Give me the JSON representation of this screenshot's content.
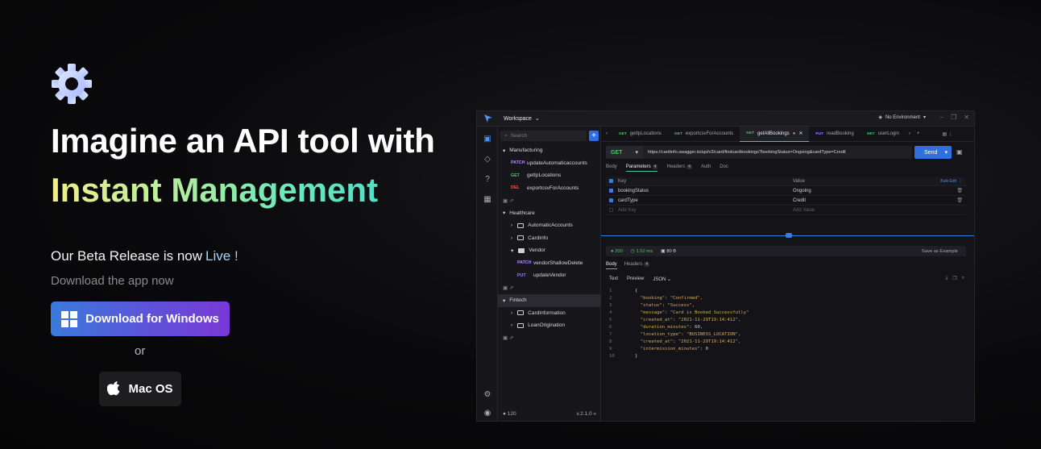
{
  "hero": {
    "headline": "Imagine an API tool with",
    "headline_gradient": "Instant Management",
    "beta_text": "Our Beta Release is now",
    "beta_live": "Live !",
    "subline": "Download the app now",
    "windows_button": "Download for Windows",
    "or": "or",
    "mac_button": "Mac OS"
  },
  "app": {
    "workspace": "Workspace",
    "environment": "No Environment",
    "search_placeholder": "Search",
    "tree": [
      {
        "type": "collection",
        "label": "Manufacturing"
      },
      {
        "type": "request",
        "method": "PATCH",
        "label": "updateAutomaticaccounts"
      },
      {
        "type": "request",
        "method": "GET",
        "label": "getIpLocations"
      },
      {
        "type": "request",
        "method": "DEL",
        "label": "exportcsvForAccounts"
      },
      {
        "type": "collection",
        "label": "Healthcare"
      },
      {
        "type": "folder",
        "label": "AutomaticAccounts"
      },
      {
        "type": "folder",
        "label": "CardInfo"
      },
      {
        "type": "folder",
        "label": "Vendor"
      },
      {
        "type": "request",
        "method": "PATCH",
        "label": "vendorShallowDelete"
      },
      {
        "type": "request",
        "method": "PUT",
        "label": "updateVendor"
      },
      {
        "type": "collection",
        "label": "Fintech"
      },
      {
        "type": "folder",
        "label": "CardInformation"
      },
      {
        "type": "folder",
        "label": "LoanOrigination"
      }
    ],
    "footer": {
      "stars": "120",
      "version": "v.2.1.0"
    },
    "tabs": [
      {
        "method": "GET",
        "label": "getIpLocations"
      },
      {
        "method": "GET",
        "label": "exportcsvForAccounts"
      },
      {
        "method": "GET",
        "label": "getAllBookings"
      },
      {
        "method": "PUT",
        "label": "readBooking"
      },
      {
        "method": "GET",
        "label": "userLogin"
      }
    ],
    "request": {
      "method": "GET",
      "url": "https://cardinfo.swagger.io/api/v3/card/findcardbookings?bookingStatus=Ongoing&cardType=Credit",
      "send": "Send"
    },
    "subtabs": {
      "body": "Body",
      "parameters": "Parameters",
      "parameters_count": "4",
      "headers": "Headers",
      "headers_count": "4",
      "auth": "Auth",
      "doc": "Doc"
    },
    "params": {
      "key_header": "Key",
      "value_header": "Value",
      "bulk_edit": "Bulk Edit",
      "rows": [
        {
          "key": "bookingStatus",
          "value": "Ongoing"
        },
        {
          "key": "cardType",
          "value": "Credit"
        }
      ],
      "add_key": "Add Key",
      "add_value": "Add Value"
    },
    "response": {
      "status": "200",
      "time": "1.52 ms",
      "size": "80 B",
      "save_example": "Save as Example",
      "tab_body": "Body",
      "tab_headers": "Headers",
      "headers_count": "4",
      "fmt_text": "Text",
      "fmt_preview": "Preview",
      "fmt_json": "JSON",
      "code": [
        {
          "n": "1",
          "t": "{"
        },
        {
          "n": "2",
          "k": "\"booking\"",
          "v": "\"Confirmed\","
        },
        {
          "n": "3",
          "k": "\"status\"",
          "v": "\"Success\","
        },
        {
          "n": "4",
          "k": "\"message\"",
          "v": "\"Card is Booked Successfully\""
        },
        {
          "n": "5",
          "k": "\"created_at\"",
          "v": "\"2021-11-29T19:14:412\","
        },
        {
          "n": "6",
          "k": "\"duration_minutes\"",
          "v": "60,"
        },
        {
          "n": "7",
          "k": "\"location_type\"",
          "v": "\"BUSINESS_LOCATION\","
        },
        {
          "n": "8",
          "k": "\"created_at\"",
          "v": "\"2021-11-29T19:14:412\","
        },
        {
          "n": "9",
          "k": "\"intermission_minutes\"",
          "v": "0"
        },
        {
          "n": "10",
          "t": "}"
        }
      ]
    }
  },
  "colors": {
    "accent": "#2f6fe0",
    "get": "#54c06e",
    "patch": "#b48cff",
    "del": "#ef5a5a"
  }
}
